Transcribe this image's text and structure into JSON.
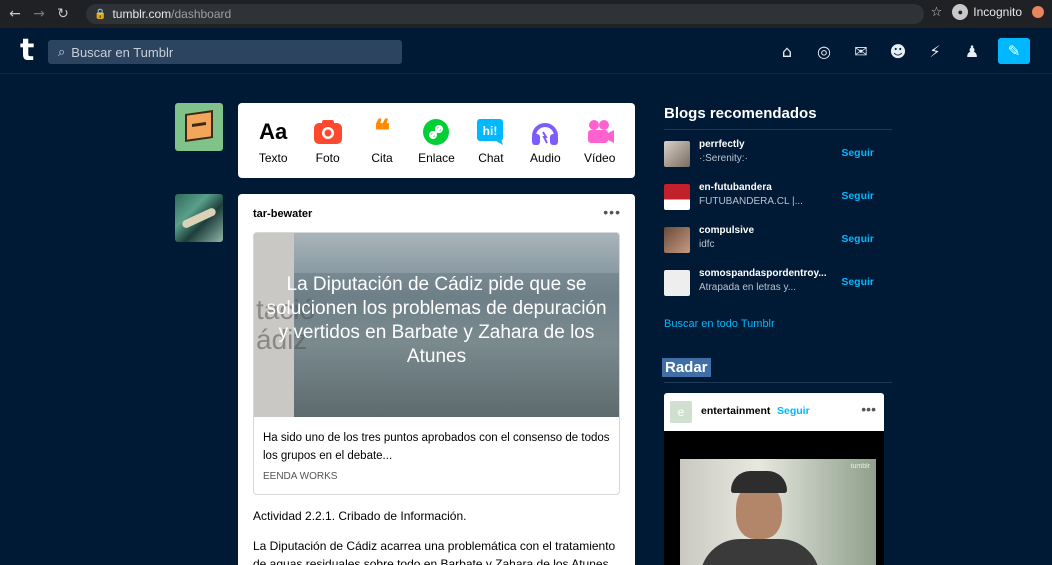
{
  "browser": {
    "url_domain": "tumblr.com",
    "url_path": "/dashboard",
    "incognito_label": "Incognito"
  },
  "header": {
    "logo": "t",
    "search_placeholder": "Buscar en Tumblr"
  },
  "compose": {
    "types": [
      {
        "label": "Texto",
        "glyph": "Aa",
        "color": "#000000"
      },
      {
        "label": "Foto",
        "glyph": "◙",
        "color": "#ff492f"
      },
      {
        "label": "Cita",
        "glyph": "66",
        "color": "#ff8a00"
      },
      {
        "label": "Enlace",
        "glyph": "∂",
        "color": "#00cf35"
      },
      {
        "label": "Chat",
        "glyph": "hi!",
        "color": "#00b8ff"
      },
      {
        "label": "Audio",
        "glyph": "♫",
        "color": "#7c5cff"
      },
      {
        "label": "Vídeo",
        "glyph": "■",
        "color": "#ff62ce"
      }
    ]
  },
  "post": {
    "author": "tar-bewater",
    "more": "•••",
    "link_title": "La Diputación de Cádiz pide que se solucionen los problemas de depuración y vertidos en Barbate y Zahara de los Atunes",
    "image_text": "tació\nádiz",
    "link_description": "Ha sido uno de los tres puntos aprobados con el consenso de todos los grupos en el debate...",
    "link_source": "EENDA WORKS",
    "body_line1": "Actividad 2.2.1. Cribado de Información.",
    "body_line2": "La Diputación de Cádiz acarrea una problemática con el tratamiento de aguas residuales sobre todo en Barbate y Zahara de los Atunes."
  },
  "recommended": {
    "title": "Blogs recomendados",
    "follow_label": "Seguir",
    "items": [
      {
        "name": "perrfectly",
        "subtitle": "·:Serenity:·",
        "avatar_color": "#9c8f88"
      },
      {
        "name": "en-futubandera",
        "subtitle": "FUTUBANDERA.CL |...",
        "avatar_color": "#c0212b"
      },
      {
        "name": "compulsive",
        "subtitle": "idfc",
        "avatar_color": "#b89078"
      },
      {
        "name": "somospandaspordentroy...",
        "subtitle": "Atrapada en letras y...",
        "avatar_color": "#eeeeee"
      }
    ],
    "explore_link": "Buscar en todo Tumblr"
  },
  "radar": {
    "title": "Radar",
    "blog_name": "entertainment",
    "follow_label": "Seguir",
    "more": "•••",
    "avatar_letter": "e",
    "watermark": "tumblr"
  }
}
